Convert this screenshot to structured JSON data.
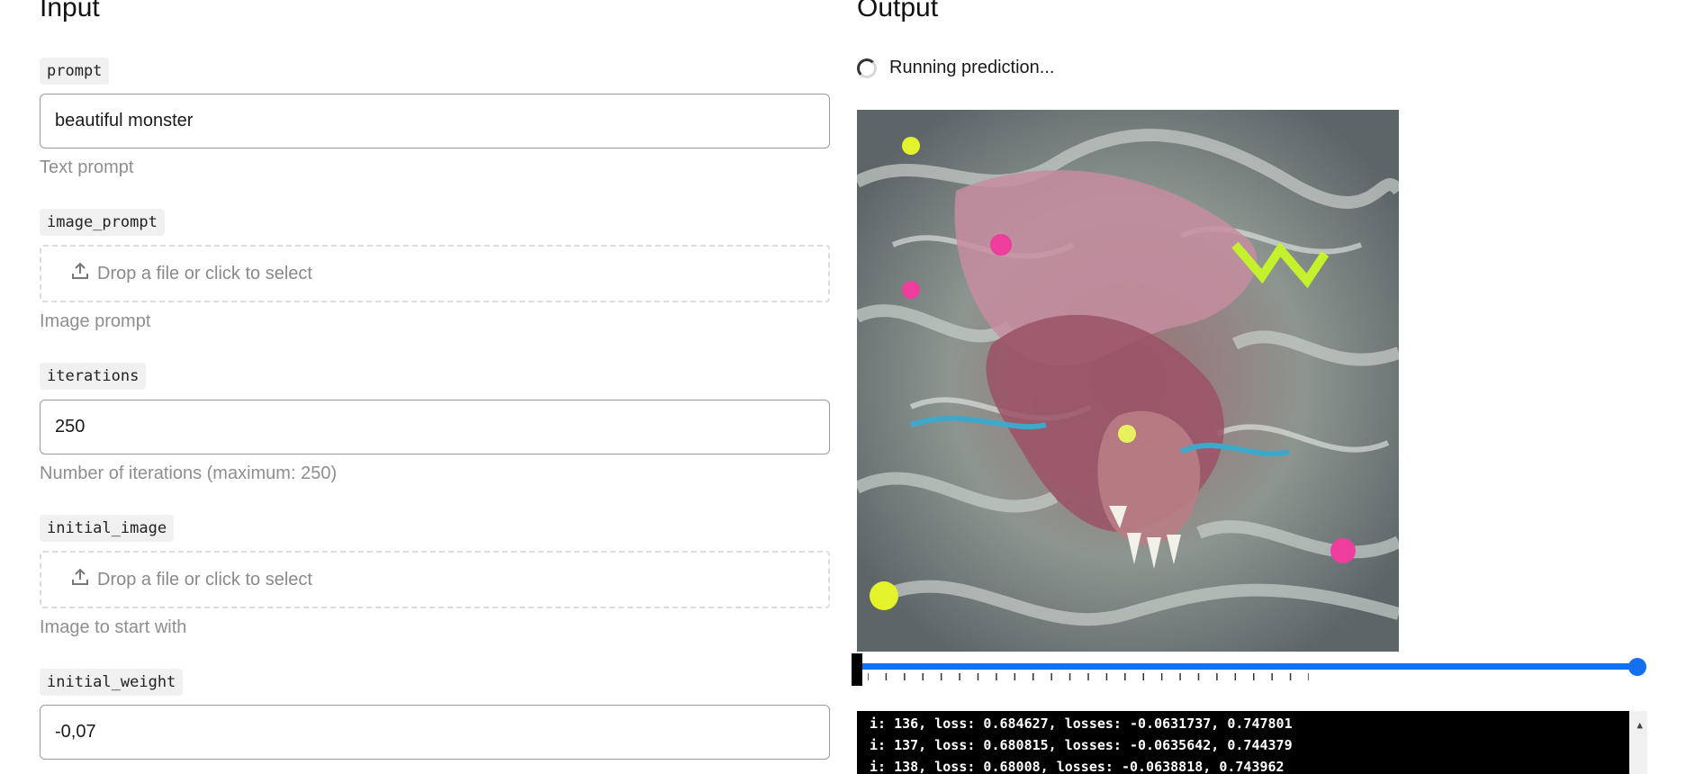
{
  "input": {
    "title": "Input",
    "fields": {
      "prompt": {
        "label": "prompt",
        "value": "beautiful monster",
        "hint": "Text prompt"
      },
      "image_prompt": {
        "label": "image_prompt",
        "drop_text": "Drop a file or click to select",
        "hint": "Image prompt"
      },
      "iterations": {
        "label": "iterations",
        "value": "250",
        "hint": "Number of iterations (maximum: 250)"
      },
      "initial_image": {
        "label": "initial_image",
        "drop_text": "Drop a file or click to select",
        "hint": "Image to start with"
      },
      "initial_weight": {
        "label": "initial_weight",
        "value": "-0,07"
      }
    }
  },
  "output": {
    "title": "Output",
    "status": "Running prediction...",
    "image": {
      "subject": "generated monster image"
    },
    "progress": {
      "ticks": 25,
      "position_fraction": 0.0
    },
    "log_lines": [
      "i: 136, loss: 0.684627, losses: -0.0631737, 0.747801",
      "i: 137, loss: 0.680815, losses: -0.0635642, 0.744379",
      "i: 138, loss: 0.68008, losses: -0.0638818, 0.743962"
    ]
  },
  "colors": {
    "accent": "#1570ef",
    "log_background": "#000000"
  }
}
